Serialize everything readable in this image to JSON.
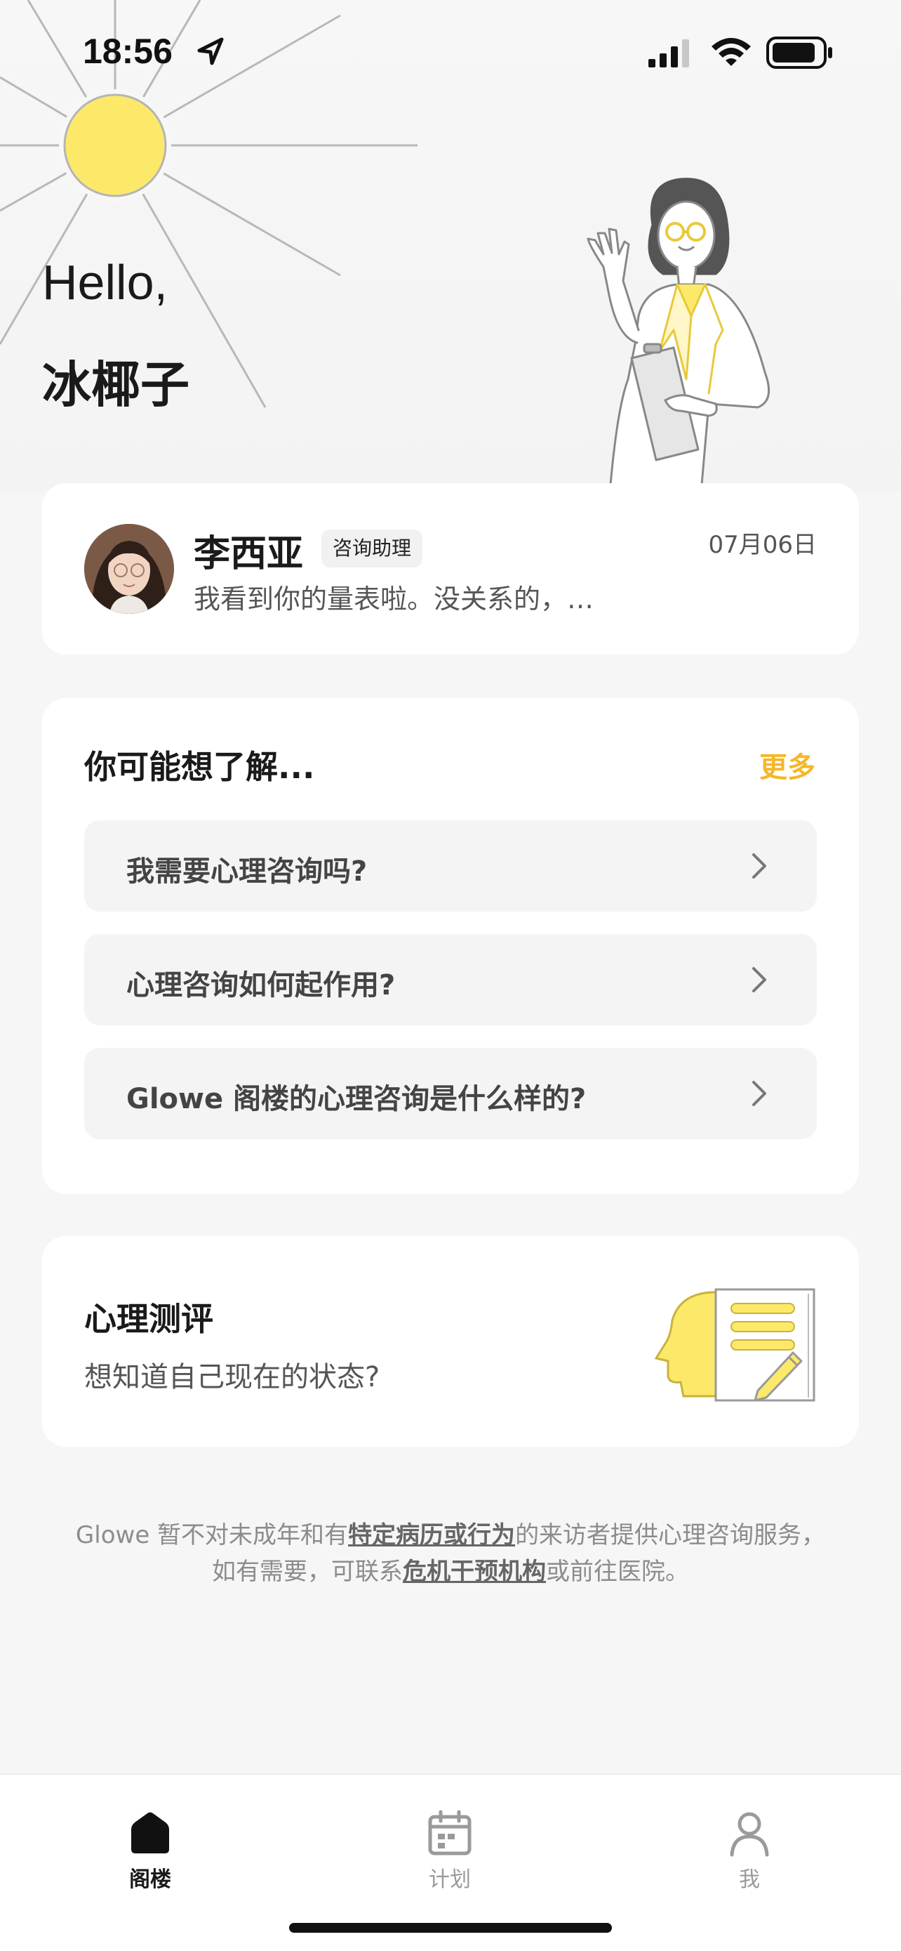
{
  "status_bar": {
    "time": "18:56",
    "icons": [
      "location-arrow-icon",
      "signal-icon",
      "wifi-icon",
      "battery-icon"
    ]
  },
  "greeting": {
    "hello": "Hello,",
    "name": "冰椰子"
  },
  "message_card": {
    "sender_name": "李西亚",
    "role_badge": "咨询助理",
    "date": "07月06日",
    "preview": "我看到你的量表啦。没关系的，…"
  },
  "faq": {
    "title": "你可能想了解...",
    "more_label": "更多",
    "items": [
      {
        "label": "我需要心理咨询吗?"
      },
      {
        "label": "心理咨询如何起作用?"
      },
      {
        "label": "Glowe 阁楼的心理咨询是什么样的?"
      }
    ]
  },
  "assessment": {
    "title": "心理测评",
    "subtitle": "想知道自己现在的状态?"
  },
  "disclaimer": {
    "line1_prefix": "Glowe 暂不对未成年和有",
    "line1_link": "特定病历或行为",
    "line1_suffix": "的来访者提供心理咨询服务，",
    "line2_prefix": "如有需要，可联系",
    "line2_link": "危机干预机构",
    "line2_suffix": "或前往医院。"
  },
  "tabbar": {
    "tabs": [
      {
        "label": "阁楼",
        "icon": "home-icon",
        "active": true
      },
      {
        "label": "计划",
        "icon": "calendar-icon",
        "active": false
      },
      {
        "label": "我",
        "icon": "person-icon",
        "active": false
      }
    ]
  },
  "colors": {
    "accent_yellow": "#f5b728",
    "sun_yellow": "#fce96a",
    "background": "#f6f6f6",
    "card": "#ffffff"
  }
}
